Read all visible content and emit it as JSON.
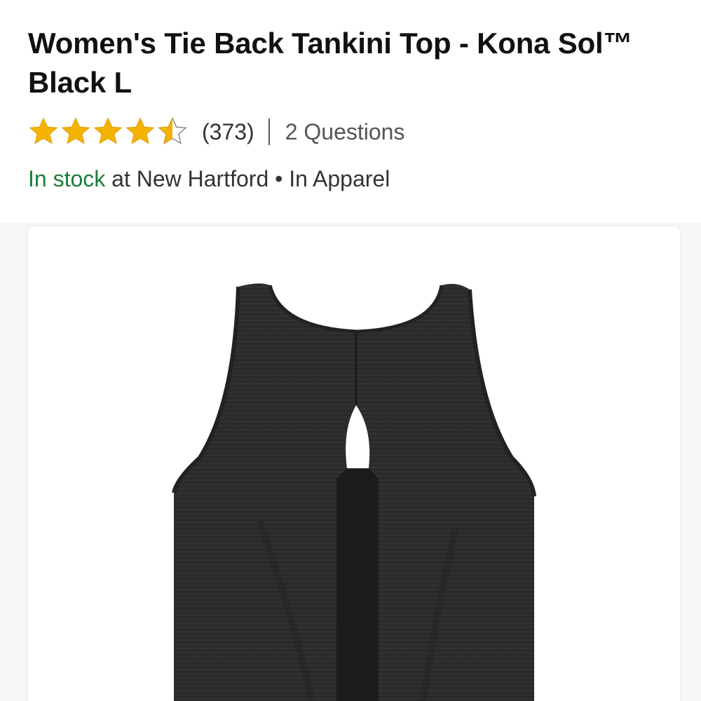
{
  "product": {
    "title": "Women's Tie Back Tankini Top - Kona Sol™ Black L",
    "rating": {
      "value": 4.5,
      "max": 5,
      "star_color": "#f5b301",
      "review_count": "(373)"
    },
    "questions_label": "2 Questions",
    "availability": {
      "status": "In stock",
      "location": "at New Hartford",
      "separator": "•",
      "department": "In Apparel",
      "status_color": "#1a7f37"
    },
    "image": {
      "subject": "black tie-back tankini top",
      "garment_color": "#2b2b2b"
    }
  }
}
